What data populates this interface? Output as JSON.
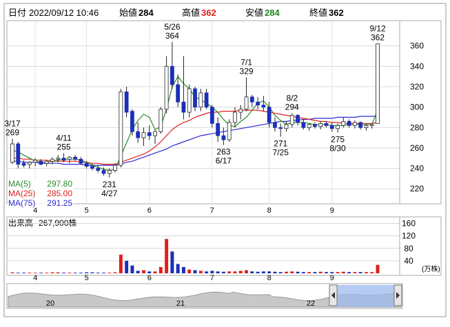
{
  "header": {
    "date_label": "日付",
    "datetime": "2022/09/12 10:46",
    "open_label": "始値",
    "open": "284",
    "high_label": "高値",
    "high": "362",
    "low_label": "安値",
    "low": "284",
    "close_label": "終値",
    "close": "362"
  },
  "colors": {
    "up": "#e0201c",
    "down": "#1c2fb8",
    "ma5": "#2a8a2a",
    "ma25": "#e0201c",
    "ma75": "#2a2ad0",
    "volume_up": "#e0201c",
    "volume_down": "#1c2fb8"
  },
  "legend": [
    {
      "name": "MA(5)",
      "value": "297.80"
    },
    {
      "name": "MA(25)",
      "value": "285.00"
    },
    {
      "name": "MA(75)",
      "value": "291.25"
    }
  ],
  "volume_panel": {
    "label": "出来高",
    "value": "267,900株",
    "unit": "(万株)"
  },
  "navigator": {
    "labels": [
      "20",
      "21",
      "22"
    ]
  },
  "chart_data": [
    {
      "type": "candlestick",
      "x_ticks": [
        "4",
        "5",
        "6",
        "7",
        "8",
        "9"
      ],
      "y_ticks": [
        220,
        240,
        260,
        280,
        300,
        320,
        340,
        360
      ],
      "ylim": [
        208,
        378
      ],
      "annotations": [
        {
          "date": "3/17",
          "value": "269",
          "kind": "high"
        },
        {
          "date": "4/11",
          "value": "255",
          "kind": "high"
        },
        {
          "date": "4/27",
          "value": "231",
          "kind": "low"
        },
        {
          "date": "5/26",
          "value": "364",
          "kind": "high"
        },
        {
          "date": "6/17",
          "value": "263",
          "kind": "low"
        },
        {
          "date": "7/1",
          "value": "329",
          "kind": "high"
        },
        {
          "date": "7/25",
          "value": "271",
          "kind": "low"
        },
        {
          "date": "8/2",
          "value": "294",
          "kind": "high"
        },
        {
          "date": "8/30",
          "value": "275",
          "kind": "low"
        },
        {
          "date": "9/12",
          "value": "362",
          "kind": "high"
        }
      ],
      "candles": [
        [
          246,
          269,
          244,
          264
        ],
        [
          264,
          266,
          240,
          244
        ],
        [
          245,
          248,
          241,
          243
        ],
        [
          244,
          247,
          240,
          246
        ],
        [
          246,
          250,
          242,
          248
        ],
        [
          247,
          249,
          243,
          244
        ],
        [
          245,
          248,
          242,
          247
        ],
        [
          247,
          251,
          244,
          249
        ],
        [
          249,
          253,
          246,
          250
        ],
        [
          250,
          255,
          246,
          248
        ],
        [
          249,
          252,
          245,
          251
        ],
        [
          251,
          253,
          247,
          249
        ],
        [
          249,
          251,
          244,
          245
        ],
        [
          245,
          247,
          240,
          242
        ],
        [
          242,
          245,
          238,
          240
        ],
        [
          240,
          243,
          236,
          238
        ],
        [
          238,
          241,
          233,
          235
        ],
        [
          235,
          240,
          231,
          238
        ],
        [
          238,
          245,
          236,
          243
        ],
        [
          243,
          318,
          241,
          315
        ],
        [
          315,
          320,
          290,
          295
        ],
        [
          296,
          298,
          272,
          276
        ],
        [
          276,
          285,
          265,
          270
        ],
        [
          270,
          280,
          262,
          275
        ],
        [
          275,
          282,
          268,
          272
        ],
        [
          272,
          278,
          264,
          276
        ],
        [
          276,
          300,
          274,
          298
        ],
        [
          298,
          350,
          294,
          340
        ],
        [
          340,
          364,
          318,
          322
        ],
        [
          322,
          332,
          300,
          305
        ],
        [
          305,
          350,
          288,
          295
        ],
        [
          295,
          322,
          290,
          318
        ],
        [
          318,
          320,
          296,
          300
        ],
        [
          300,
          318,
          296,
          314
        ],
        [
          314,
          318,
          298,
          300
        ],
        [
          300,
          302,
          280,
          284
        ],
        [
          284,
          290,
          266,
          272
        ],
        [
          272,
          280,
          263,
          268
        ],
        [
          268,
          288,
          266,
          285
        ],
        [
          285,
          300,
          280,
          295
        ],
        [
          295,
          302,
          288,
          298
        ],
        [
          298,
          329,
          296,
          310
        ],
        [
          310,
          312,
          300,
          305
        ],
        [
          305,
          310,
          298,
          302
        ],
        [
          302,
          311,
          296,
          300
        ],
        [
          300,
          305,
          280,
          285
        ],
        [
          285,
          290,
          276,
          280
        ],
        [
          280,
          284,
          271,
          279
        ],
        [
          279,
          286,
          276,
          283
        ],
        [
          283,
          294,
          280,
          292
        ],
        [
          292,
          293,
          282,
          285
        ],
        [
          285,
          288,
          278,
          280
        ],
        [
          280,
          284,
          277,
          283
        ],
        [
          283,
          285,
          279,
          281
        ],
        [
          281,
          286,
          278,
          284
        ],
        [
          284,
          286,
          280,
          282
        ],
        [
          282,
          285,
          276,
          279
        ],
        [
          279,
          284,
          275,
          282
        ],
        [
          282,
          290,
          280,
          286
        ],
        [
          286,
          288,
          280,
          282
        ],
        [
          282,
          287,
          279,
          285
        ],
        [
          285,
          286,
          278,
          280
        ],
        [
          280,
          284,
          277,
          282
        ],
        [
          282,
          284,
          279,
          283
        ],
        [
          284,
          362,
          284,
          362
        ]
      ],
      "ma5": [
        258,
        256,
        253,
        250,
        247,
        246,
        246,
        247,
        248,
        249,
        249,
        249,
        248,
        246,
        243,
        241,
        239,
        238,
        239,
        252,
        265,
        278,
        287,
        293,
        290,
        278,
        281,
        298,
        320,
        330,
        323,
        318,
        310,
        307,
        304,
        300,
        295,
        288,
        282,
        281,
        286,
        290,
        297,
        304,
        306,
        300,
        292,
        287,
        283,
        285,
        285,
        285,
        284,
        283,
        283,
        283,
        282,
        282,
        282,
        283,
        283,
        283,
        283,
        283,
        297
      ],
      "ma25": [
        250,
        250,
        249,
        249,
        248,
        248,
        248,
        247,
        247,
        247,
        247,
        247,
        246,
        246,
        245,
        245,
        244,
        244,
        244,
        246,
        248,
        250,
        252,
        254,
        257,
        261,
        266,
        272,
        278,
        282,
        285,
        287,
        290,
        292,
        294,
        295,
        295,
        296,
        296,
        296,
        297,
        297,
        297,
        297,
        296,
        295,
        294,
        293,
        292,
        291,
        290,
        289,
        288,
        287,
        286,
        286,
        285,
        285,
        284,
        284,
        284,
        284,
        284,
        284,
        285
      ],
      "ma75": [
        247,
        247,
        246,
        246,
        246,
        245,
        245,
        245,
        245,
        244,
        244,
        244,
        244,
        243,
        243,
        243,
        243,
        243,
        243,
        244,
        246,
        247,
        249,
        251,
        253,
        255,
        257,
        259,
        262,
        264,
        266,
        268,
        270,
        272,
        273,
        274,
        275,
        276,
        277,
        278,
        279,
        280,
        281,
        282,
        283,
        284,
        285,
        286,
        286,
        287,
        287,
        288,
        288,
        289,
        289,
        289,
        289,
        290,
        290,
        290,
        290,
        291,
        291,
        291,
        291
      ],
      "volume": [
        3,
        2,
        2,
        2,
        2,
        2,
        2,
        3,
        3,
        2,
        2,
        2,
        2,
        3,
        3,
        2,
        2,
        2,
        3,
        60,
        40,
        25,
        8,
        10,
        6,
        6,
        20,
        110,
        70,
        30,
        20,
        12,
        10,
        8,
        6,
        8,
        6,
        5,
        6,
        6,
        8,
        10,
        6,
        5,
        6,
        6,
        5,
        4,
        5,
        6,
        5,
        4,
        4,
        4,
        5,
        4,
        4,
        4,
        5,
        4,
        4,
        4,
        4,
        4,
        27
      ],
      "volume_ylim": [
        0,
        170
      ],
      "volume_ticks": [
        40,
        80,
        120,
        160
      ]
    }
  ]
}
